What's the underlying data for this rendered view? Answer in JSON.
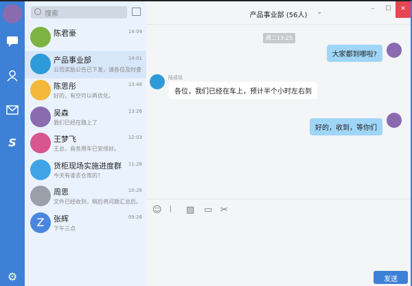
{
  "search": {
    "placeholder": "搜索"
  },
  "conversations": [
    {
      "name": "陈君豪",
      "preview": "",
      "time": "14:04",
      "color": "#7cb342"
    },
    {
      "name": "产品事业部",
      "preview": "公司奖励公告已下发，请各位及时查",
      "time": "14:01",
      "color": "#2e9bd8"
    },
    {
      "name": "陈思彤",
      "preview": "好的，有空可以再优化。",
      "time": "13:46",
      "color": "#f4b93a"
    },
    {
      "name": "吴森",
      "preview": "我们已经在路上了",
      "time": "13:26",
      "color": "#8a6bb0"
    },
    {
      "name": "王梦飞",
      "preview": "王总，商务用车已安排好。",
      "time": "12:03",
      "color": "#d9558f"
    },
    {
      "name": "货柜现场实施进度群",
      "preview": "今天有谁去仓库的?",
      "time": "11:26",
      "color": "#3fa3e8"
    },
    {
      "name": "周思",
      "preview": "文件已经收到，稍后将问题汇总后。",
      "time": "10:26",
      "color": "#9aa0a8"
    },
    {
      "name": "张辉",
      "preview": "下午三点",
      "time": "09:26",
      "color": "#4a86e0",
      "letter": "Z"
    }
  ],
  "chat": {
    "title": "产品事业部 (56人)",
    "timestamp": "周二13:25",
    "messages": [
      {
        "text": "大家都到哪啦?",
        "side": "right"
      },
      {
        "sender": "陆成铭",
        "text": "各位，我们已经在车上，预计半个小时左右到",
        "side": "left"
      },
      {
        "text": "好的，收到，等你们",
        "side": "right"
      }
    ],
    "send_label": "发送"
  },
  "window": {
    "minimize": "–",
    "maximize": "☐",
    "close": "✕"
  },
  "colors": {
    "accent": "#3d80d6",
    "bubble": "#9fd6f7"
  }
}
